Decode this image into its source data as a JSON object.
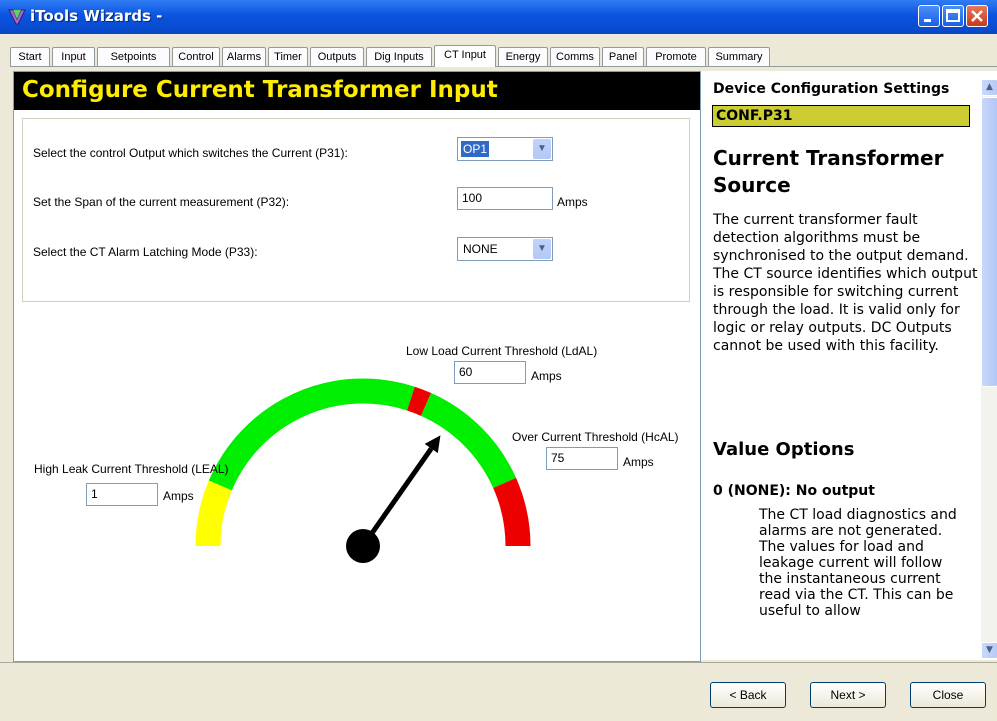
{
  "window": {
    "title": "iTools Wizards -"
  },
  "tabs": [
    "Start",
    "Input",
    "Setpoints",
    "Control",
    "Alarms",
    "Timer",
    "Outputs",
    "Dig Inputs",
    "CT Input",
    "Energy",
    "Comms",
    "Panel",
    "Promote",
    "Summary"
  ],
  "active_tab": "CT Input",
  "page": {
    "header": "Configure Current Transformer Input",
    "fields": [
      {
        "label": "Select the control Output which switches the Current (P31):",
        "value": "OP1"
      },
      {
        "label": "Set the Span of the current measurement (P32):",
        "value": "100",
        "unit": "Amps"
      },
      {
        "label": "Select the CT Alarm Latching Mode (P33):",
        "value": "NONE"
      }
    ],
    "gauge": {
      "low_load": {
        "label": "Low Load Current Threshold (LdAL)",
        "value": "60",
        "unit": "Amps"
      },
      "over_current": {
        "label": "Over Current Threshold (HcAL)",
        "value": "75",
        "unit": "Amps"
      },
      "high_leak": {
        "label": "High Leak Current Threshold (LEAL)",
        "value": "1",
        "unit": "Amps"
      },
      "colors": {
        "green": "#00ee00",
        "red": "#ee0000",
        "yellow": "#ffff00"
      }
    }
  },
  "help": {
    "heading": "Device Configuration Settings",
    "code": "CONF.P31",
    "title": "Current Transformer Source",
    "description": "The current transformer fault detection algorithms must be synchronised to the output demand. The CT source identifies which output is responsible for switching current through the load. It is valid only for logic or relay outputs. DC Outputs cannot be used with this facility.",
    "subheading": "Value Options",
    "option_title": "0 (NONE): No output",
    "option_desc": "The CT load diagnostics and alarms are not generated. The values for load and leakage current will follow the instantaneous current read via the CT. This can be useful to allow"
  },
  "buttons": {
    "back": "< Back",
    "next": "Next >",
    "close": "Close"
  }
}
